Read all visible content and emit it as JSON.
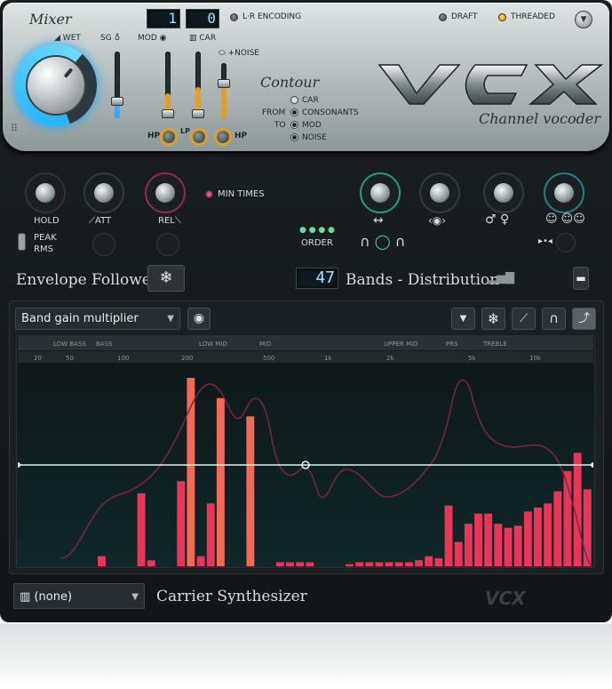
{
  "mixer": {
    "title": "Mixer",
    "wet_label": "WET",
    "sg_label": "SG",
    "mod_label": "MOD",
    "car_label": "CAR",
    "lcd_left": "1",
    "lcd_right": "0",
    "noise_label": "+NOISE",
    "hp_label": "HP",
    "lp_label": "LP",
    "hp2_label": "HP"
  },
  "header": {
    "lr_encoding": "L·R ENCODING",
    "draft": "DRAFT",
    "threaded": "THREADED"
  },
  "contour": {
    "title": "Contour",
    "from_label": "FROM",
    "to_label": "TO",
    "options": [
      "CAR",
      "CONSONANTS",
      "MOD",
      "NOISE"
    ]
  },
  "logo": {
    "subtitle": "Channel vocoder"
  },
  "envelope": {
    "hold": "HOLD",
    "att": "ATT",
    "rel": "REL",
    "min_times": "MIN TIMES",
    "peak": "PEAK",
    "rms": "RMS",
    "order": "ORDER",
    "title": "Envelope Follower"
  },
  "bands": {
    "count": "47",
    "title": "Bands - Distribution"
  },
  "graph": {
    "mode": "Band gain multiplier",
    "ranges": [
      "LOW BASS",
      "BASS",
      "LOW MID",
      "MID",
      "UPPER MID",
      "PRS",
      "TREBLE"
    ],
    "freqs": [
      "20",
      "50",
      "100",
      "200",
      "500",
      "1k",
      "2k",
      "5k",
      "10k"
    ],
    "line_level": 0.5,
    "bar_levels": [
      0.05,
      0.0,
      0.0,
      0.0,
      0.36,
      0.03,
      0.0,
      0.0,
      0.42,
      0.93,
      0.05,
      0.31,
      0.83,
      0.0,
      0.0,
      0.74,
      0.0,
      0.0,
      0.02,
      0.02,
      0.02,
      0.02,
      0.0,
      0.0,
      0.0,
      0.01,
      0.02,
      0.02,
      0.02,
      0.02,
      0.02,
      0.02,
      0.03,
      0.05,
      0.04,
      0.3,
      0.12,
      0.21,
      0.26,
      0.26,
      0.21,
      0.19,
      0.2,
      0.27,
      0.29,
      0.31,
      0.37,
      0.47,
      0.56,
      0.38
    ]
  },
  "carrier": {
    "selected": "(none)",
    "title": "Carrier Synthesizer"
  }
}
